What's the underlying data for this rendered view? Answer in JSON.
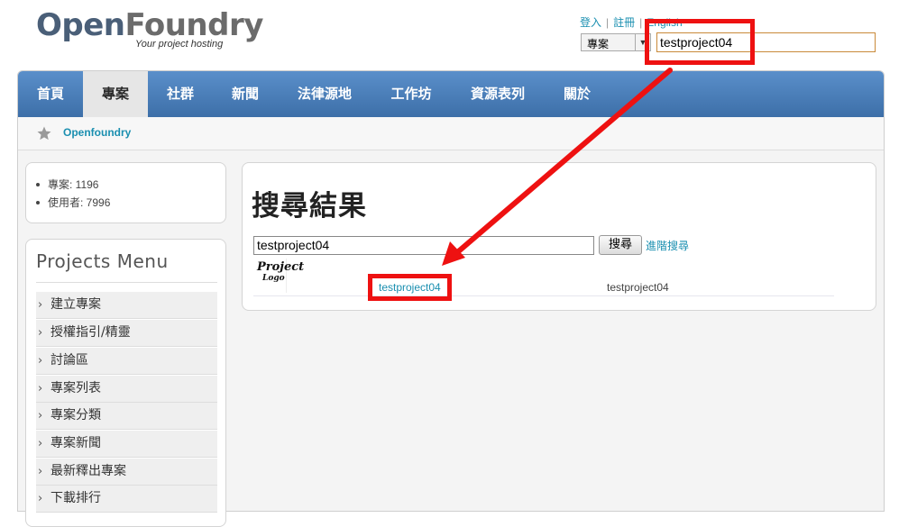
{
  "logo": {
    "word_open": "Open",
    "word_foundry": "Foundry",
    "tagline": "Your project hosting"
  },
  "top_links": [
    {
      "label": "登入"
    },
    {
      "label": "註冊"
    },
    {
      "label": "English"
    }
  ],
  "scope_select": {
    "value": "專案"
  },
  "top_search": {
    "value": "testproject04"
  },
  "nav": {
    "items": [
      {
        "label": "首頁",
        "active": false
      },
      {
        "label": "專案",
        "active": true
      },
      {
        "label": "社群",
        "active": false
      },
      {
        "label": "新聞",
        "active": false
      },
      {
        "label": "法律源地",
        "active": false
      },
      {
        "label": "工作坊",
        "active": false
      },
      {
        "label": "資源表列",
        "active": false
      },
      {
        "label": "關於",
        "active": false
      }
    ]
  },
  "breadcrumb": {
    "label": "Openfoundry"
  },
  "stats": [
    {
      "label": "專案: 1196"
    },
    {
      "label": "使用者: 7996"
    }
  ],
  "projects_menu": {
    "title": "Projects Menu",
    "items": [
      {
        "label": "建立專案"
      },
      {
        "label": "授權指引/精靈"
      },
      {
        "label": "討論區"
      },
      {
        "label": "專案列表"
      },
      {
        "label": "專案分類"
      },
      {
        "label": "專案新聞"
      },
      {
        "label": "最新釋出專案"
      },
      {
        "label": "下載排行"
      }
    ]
  },
  "main": {
    "title": "搜尋結果",
    "search_value": "testproject04",
    "search_button": "搜尋",
    "advanced_link": "進階搜尋",
    "results": [
      {
        "logo_line1": "Project",
        "logo_line2": "Logo",
        "name": "testproject04",
        "description": "testproject04"
      }
    ]
  },
  "colors": {
    "nav": "#4a7dbb",
    "link": "#1a8fb0",
    "annotation": "#ee1111"
  }
}
